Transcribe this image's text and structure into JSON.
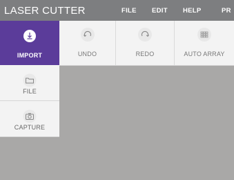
{
  "app": {
    "title": "LASER CUTTER"
  },
  "menu": [
    {
      "label": "FILE"
    },
    {
      "label": "EDIT"
    },
    {
      "label": "HELP"
    },
    {
      "label": "PR"
    }
  ],
  "toolbar": {
    "items": [
      {
        "label": "UNDO",
        "icon": "undo-icon"
      },
      {
        "label": "REDO",
        "icon": "redo-icon"
      },
      {
        "label": "AUTO ARRAY",
        "icon": "grid-icon"
      }
    ]
  },
  "sidebar": {
    "items": [
      {
        "label": "IMPORT",
        "icon": "import-icon",
        "active": true
      },
      {
        "label": "FILE",
        "icon": "folder-icon",
        "active": false
      },
      {
        "label": "CAPTURE",
        "icon": "camera-icon",
        "active": false
      }
    ]
  },
  "colors": {
    "accent": "#5b3c9a",
    "titlebar": "#7d7e80",
    "workspace": "#a9a8a7"
  }
}
